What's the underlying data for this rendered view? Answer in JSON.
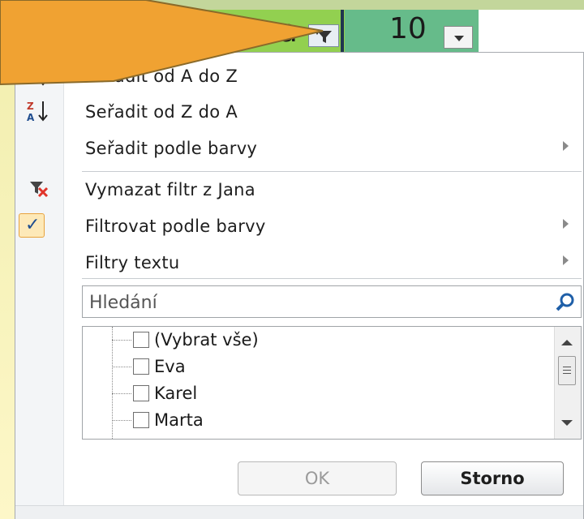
{
  "spreadsheet": {
    "cell_name": "Jana",
    "cell_value": "10"
  },
  "menu": {
    "items": [
      {
        "label": "Seřadit od A do Z",
        "icon": "sort-az-icon",
        "submenu": false
      },
      {
        "label": "Seřadit od Z do A",
        "icon": "sort-za-icon",
        "submenu": false
      },
      {
        "label": "Seřadit podle barvy",
        "icon": "",
        "submenu": true
      },
      {
        "label": "Vymazat filtr z Jana",
        "icon": "clear-filter-icon",
        "submenu": false
      },
      {
        "label": "Filtrovat podle barvy",
        "icon": "check-icon",
        "submenu": true
      },
      {
        "label": "Filtry textu",
        "icon": "",
        "submenu": true
      }
    ],
    "search": {
      "placeholder": "Hledání"
    },
    "list": [
      {
        "label": "(Vybrat vše)",
        "checked": false
      },
      {
        "label": "Eva",
        "checked": false
      },
      {
        "label": "Karel",
        "checked": false
      },
      {
        "label": "Marta",
        "checked": false
      }
    ],
    "ok_label": "OK",
    "cancel_label": "Storno",
    "check_mark": "✓"
  },
  "colors": {
    "cell_green": "#92d050",
    "cell_teal": "#66bb8a",
    "callout_arrow": "#f0a232",
    "header_band": "#c3d69b"
  }
}
